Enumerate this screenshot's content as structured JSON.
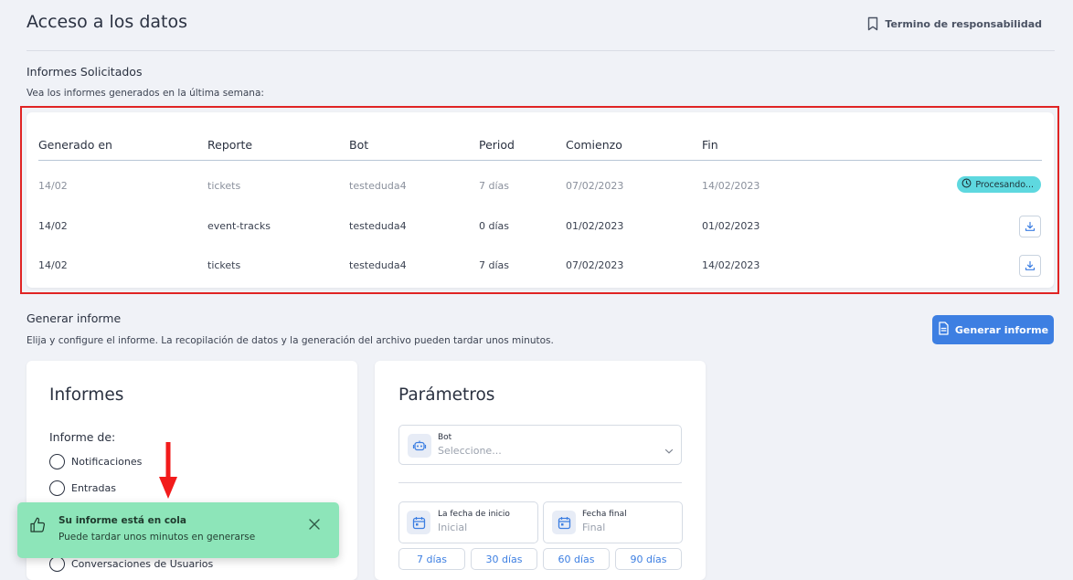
{
  "header": {
    "title": "Acceso a los datos",
    "terms_link": "Termino de responsabilidad"
  },
  "reports": {
    "title": "Informes Solicitados",
    "description": "Vea los informes generados en la última semana:",
    "columns": [
      "Generado en",
      "Reporte",
      "Bot",
      "Period",
      "Comienzo",
      "Fin"
    ],
    "rows": [
      {
        "generated": "14/02",
        "report": "tickets",
        "bot": "testeduda4",
        "period": "7 días",
        "start": "07/02/2023",
        "end": "14/02/2023",
        "status": "Procesando..."
      },
      {
        "generated": "14/02",
        "report": "event-tracks",
        "bot": "testeduda4",
        "period": "0 días",
        "start": "01/02/2023",
        "end": "01/02/2023"
      },
      {
        "generated": "14/02",
        "report": "tickets",
        "bot": "testeduda4",
        "period": "7 días",
        "start": "07/02/2023",
        "end": "14/02/2023"
      }
    ]
  },
  "generate": {
    "title": "Generar informe",
    "description": "Elija y configure el informe. La recopilación de datos y la generación del archivo pueden tardar unos minutos.",
    "button_label": "Generar informe"
  },
  "informes_card": {
    "title": "Informes",
    "label": "Informe de:",
    "options": [
      "Notificaciones",
      "Entradas",
      "Conversaciones de Usuarios"
    ]
  },
  "params_card": {
    "title": "Parámetros",
    "bot_label": "Bot",
    "bot_placeholder": "Seleccione...",
    "start_label": "La fecha de inicio",
    "start_placeholder": "Inicial",
    "end_label": "Fecha final",
    "end_placeholder": "Final",
    "ranges": [
      "7 días",
      "30 días",
      "60 días",
      "90 días"
    ]
  },
  "toast": {
    "title": "Su informe está en cola",
    "message": "Puede tardar unos minutos en generarse"
  },
  "colors": {
    "accent": "#3d7fe2",
    "status_badge": "#5ed8df",
    "toast_bg": "#8de5b9",
    "highlight": "#e02424",
    "arrow": "#f21b1b"
  }
}
